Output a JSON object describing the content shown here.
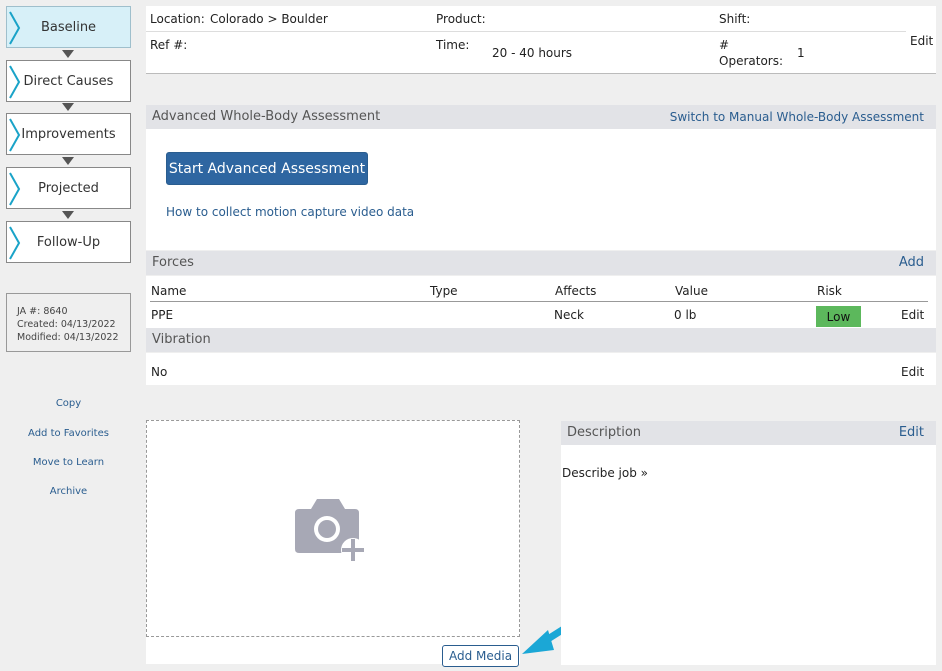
{
  "sidebar": {
    "steps": [
      {
        "label": "Baseline"
      },
      {
        "label": "Direct Causes"
      },
      {
        "label": "Improvements"
      },
      {
        "label": "Projected"
      },
      {
        "label": "Follow-Up"
      }
    ],
    "job_info": {
      "ja": "JA #: 8640",
      "created": "Created: 04/13/2022",
      "modified": "Modified: 04/13/2022"
    },
    "links": {
      "copy": "Copy",
      "favorites": "Add to Favorites",
      "learn": "Move to Learn",
      "archive": "Archive"
    }
  },
  "info": {
    "location_label": "Location:",
    "location_value": "Colorado > Boulder",
    "product_label": "Product:",
    "shift_label": "Shift:",
    "ref_label": "Ref #:",
    "time_label": "Time:",
    "time_value": "20 - 40 hours",
    "operators_label_1": "#",
    "operators_label_2": "Operators:",
    "operators_value": "1",
    "edit": "Edit"
  },
  "assessment": {
    "title": "Advanced Whole-Body Assessment",
    "switch_link": "Switch to Manual Whole-Body Assessment",
    "start_button": "Start Advanced Assessment",
    "help_link": "How to collect motion capture video data"
  },
  "forces": {
    "title": "Forces",
    "add": "Add",
    "headers": {
      "name": "Name",
      "type": "Type",
      "affects": "Affects",
      "value": "Value",
      "risk": "Risk"
    },
    "row": {
      "name": "PPE",
      "type": "",
      "affects": "Neck",
      "value": "0 lb",
      "risk": "Low",
      "edit": "Edit"
    },
    "risk_color": "#5cb85c"
  },
  "vibration": {
    "title": "Vibration",
    "value": "No",
    "edit": "Edit"
  },
  "media": {
    "icon": "camera-add-icon",
    "add_button": "Add Media"
  },
  "description": {
    "title": "Description",
    "edit": "Edit",
    "prompt": "Describe job »"
  },
  "colors": {
    "link": "#2a5d8f",
    "primary": "#2e66a1",
    "active_step": "#d7f0f8",
    "chevron": "#1aa3c8",
    "pointer_arrow": "#1ba7d6"
  }
}
